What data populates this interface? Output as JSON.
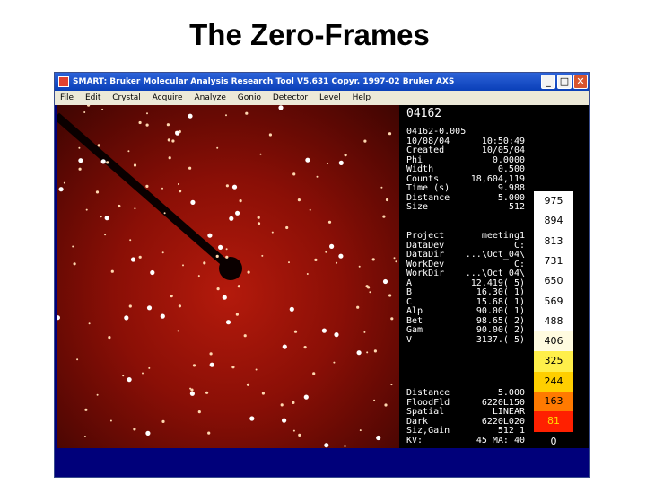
{
  "slide": {
    "title": "The Zero-Frames"
  },
  "window": {
    "title": "SMART: Bruker Molecular Analysis Research Tool V5.631 Copyr. 1997-02 Bruker AXS",
    "buttons": {
      "minimize": "_",
      "maximize": "□",
      "close": "✕"
    }
  },
  "menu": [
    "File",
    "Edit",
    "Crystal",
    "Acquire",
    "Analyze",
    "Gonio",
    "Detector",
    "Level",
    "Help"
  ],
  "info": {
    "frame_name": "04162",
    "header": [
      {
        "k": "04162-0.005",
        "v": ""
      },
      {
        "k": "10/08/04",
        "v": "10:50:49"
      },
      {
        "k": "Created",
        "v": "10/05/04"
      },
      {
        "k": "Phi",
        "v": "0.0000"
      },
      {
        "k": "Width",
        "v": "0.500"
      },
      {
        "k": "Counts",
        "v": "18,604,119"
      },
      {
        "k": "Time (s)",
        "v": "9.988"
      },
      {
        "k": "Distance",
        "v": "5.000"
      },
      {
        "k": "Size",
        "v": "512"
      }
    ],
    "project": [
      {
        "k": "Project",
        "v": "meeting1"
      },
      {
        "k": "DataDev",
        "v": "C:"
      },
      {
        "k": "DataDir",
        "v": "...\\Oct_04\\"
      },
      {
        "k": "WorkDev",
        "v": "C:"
      },
      {
        "k": "WorkDir",
        "v": "...\\Oct_04\\"
      },
      {
        "k": "A",
        "v": "12.419(  5)"
      },
      {
        "k": "B",
        "v": "16.30(  1)"
      },
      {
        "k": "C",
        "v": "15.68(  1)"
      },
      {
        "k": "Alp",
        "v": "90.00(  1)"
      },
      {
        "k": "Bet",
        "v": "98.65(  2)"
      },
      {
        "k": "Gam",
        "v": "90.00(  2)"
      },
      {
        "k": "V",
        "v": "3137.(  5)"
      }
    ],
    "footer": [
      {
        "k": "Distance",
        "v": "5.000"
      },
      {
        "k": "FloodFld",
        "v": "6220L150"
      },
      {
        "k": "Spatial",
        "v": "LINEAR"
      },
      {
        "k": "Dark",
        "v": "6220L020"
      },
      {
        "k": "Siz,Gain",
        "v": "512    1"
      },
      {
        "k": "KV:",
        "v": "45    MA:  40"
      }
    ]
  },
  "scale": {
    "labels": [
      "975",
      "894",
      "813",
      "731",
      "650",
      "569",
      "488",
      "406",
      "325",
      "244",
      "163",
      "81",
      "0"
    ],
    "colors": [
      "#ffffff",
      "#ffffff",
      "#ffffff",
      "#ffffff",
      "#ffffff",
      "#ffffff",
      "#ffffff",
      "#fffbe0",
      "#ffef4a",
      "#ffcf00",
      "#ff7a00",
      "#ff2000",
      "#000000"
    ],
    "label_colors": [
      "#000",
      "#000",
      "#000",
      "#000",
      "#000",
      "#000",
      "#000",
      "#000",
      "#000",
      "#000",
      "#000",
      "#ffdd00",
      "#ffffff"
    ]
  },
  "colors": {
    "window_bg": "#00007a",
    "diffraction_bg": "#8a0f06",
    "reflection": "#ffffff"
  }
}
